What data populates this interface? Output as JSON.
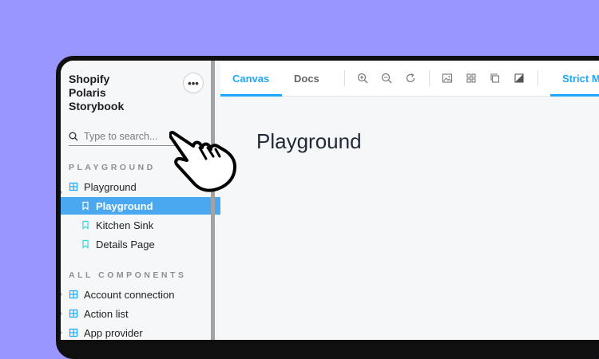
{
  "sidebar": {
    "brand_lines": [
      "Shopify",
      "Polaris",
      "Storybook"
    ],
    "menu_icon": "ellipsis-icon",
    "search": {
      "placeholder": "Type to search..."
    },
    "sections": [
      {
        "title": "PLAYGROUND",
        "items": [
          {
            "label": "Playground",
            "icon": "component-icon"
          },
          {
            "label": "Playground",
            "icon": "bookmark-icon",
            "selected": true
          },
          {
            "label": "Kitchen Sink",
            "icon": "bookmark-icon"
          },
          {
            "label": "Details Page",
            "icon": "bookmark-icon"
          }
        ]
      },
      {
        "title": "ALL COMPONENTS",
        "items": [
          {
            "label": "Account connection",
            "icon": "component-icon"
          },
          {
            "label": "Action list",
            "icon": "component-icon"
          },
          {
            "label": "App provider",
            "icon": "component-icon"
          }
        ]
      }
    ]
  },
  "toolbar": {
    "tabs": [
      "Canvas",
      "Docs"
    ],
    "tools": [
      "zoom-in-icon",
      "zoom-out-icon",
      "reset-zoom-icon",
      "image-icon",
      "grid-icon",
      "frame-icon",
      "contrast-icon"
    ],
    "strict_mode_label": "Strict M"
  },
  "main": {
    "heading": "Playground"
  },
  "colors": {
    "accent": "#1ea7fd",
    "selected_bg": "#4aa8f0",
    "background": "#9996ff"
  }
}
